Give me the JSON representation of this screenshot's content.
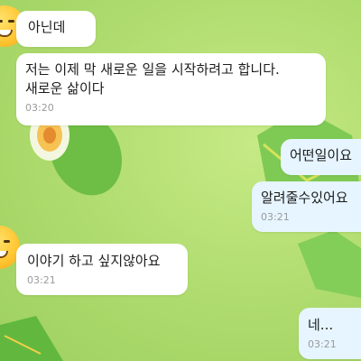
{
  "chat": {
    "messages": [
      {
        "side": "in",
        "text": "아닌데",
        "time": ""
      },
      {
        "side": "in",
        "text": "저는 이제 막 새로운 일을 시작하려고 합니다.\n새로운 삶이다",
        "time": "03:20"
      },
      {
        "side": "out",
        "text": "어떤일이요",
        "time": ""
      },
      {
        "side": "out",
        "text": "알려줄수있어요",
        "time": "03:21"
      },
      {
        "side": "in",
        "text": "이야기 하고 싶지않아요",
        "time": "03:21"
      },
      {
        "side": "out",
        "text": "네...",
        "time": "03:21"
      }
    ]
  },
  "theme": {
    "background": "#aedb6d",
    "incoming_bubble": "#ffffff",
    "outgoing_bubble": "#e6f5ff",
    "time_color": "#9a9a9a"
  },
  "icons": {
    "sender_avatar": "smiling-emoji-avatar-icon"
  }
}
